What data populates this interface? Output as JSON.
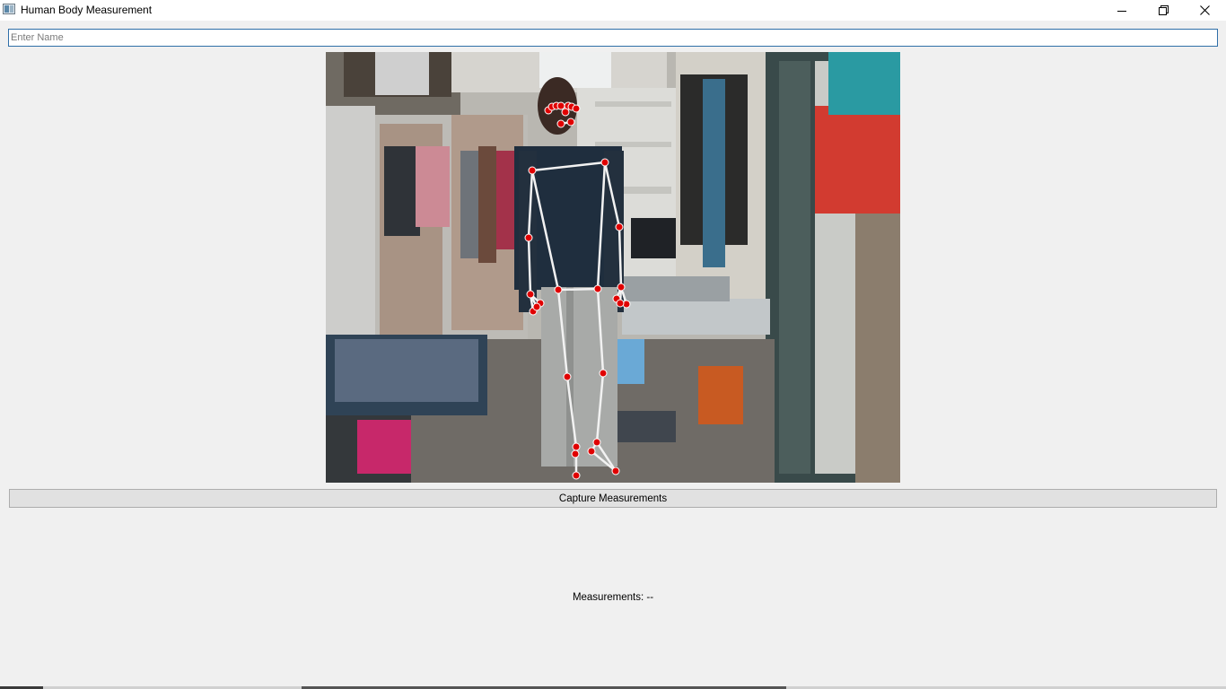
{
  "window": {
    "title": "Human Body Measurement",
    "icon": "app-window-icon",
    "controls": [
      "minimize-icon",
      "restore-icon",
      "close-icon"
    ]
  },
  "name_input": {
    "placeholder": "Enter Name",
    "value": ""
  },
  "camera_feed": {
    "overlay": "pose-skeleton",
    "joint_color": "#e00000",
    "bone_color": "#f2f2f2"
  },
  "capture_button": {
    "label": "Capture Measurements"
  },
  "measurements": {
    "text": "Measurements: --"
  }
}
